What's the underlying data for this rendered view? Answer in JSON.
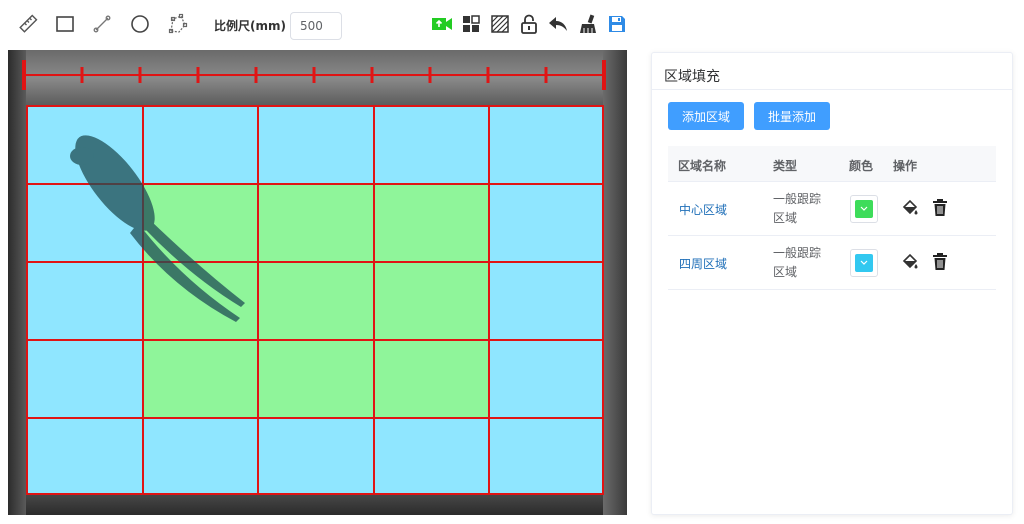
{
  "toolbar": {
    "scale_label": "比例尺(mm)",
    "scale_value": "500",
    "tools_left": [
      {
        "name": "ruler-icon"
      },
      {
        "name": "rectangle-icon"
      },
      {
        "name": "line-icon"
      },
      {
        "name": "circle-icon"
      },
      {
        "name": "polygon-icon"
      }
    ],
    "tools_right": [
      {
        "name": "video-upload-icon",
        "color": "#22cc22"
      },
      {
        "name": "layout-grid-icon"
      },
      {
        "name": "hatch-pattern-icon"
      },
      {
        "name": "unlock-icon"
      },
      {
        "name": "undo-icon"
      },
      {
        "name": "clear-brush-icon"
      },
      {
        "name": "save-icon",
        "color": "#2f8be6"
      }
    ]
  },
  "viewport": {
    "grid_color": "#e01414",
    "ruler_color": "#e01414",
    "rows": 5,
    "cols": 5,
    "cells": [
      [
        "outer",
        "outer",
        "outer",
        "outer",
        "outer"
      ],
      [
        "outer",
        "center",
        "center",
        "center",
        "outer"
      ],
      [
        "outer",
        "center",
        "center",
        "center",
        "outer"
      ],
      [
        "outer",
        "center",
        "center",
        "center",
        "outer"
      ],
      [
        "outer",
        "outer",
        "outer",
        "outer",
        "outer"
      ]
    ],
    "colors": {
      "outer": "#8fe6ff",
      "center": "#8ff59a"
    }
  },
  "panel": {
    "title": "区域填充",
    "add_button": "添加区域",
    "batch_button": "批量添加",
    "columns": {
      "name": "区域名称",
      "type": "类型",
      "color": "颜色",
      "actions": "操作"
    },
    "rows": [
      {
        "name": "中心区域",
        "type": "一般跟踪区域",
        "color": "#3ddc5a"
      },
      {
        "name": "四周区域",
        "type": "一般跟踪区域",
        "color": "#32c8f0"
      }
    ]
  }
}
